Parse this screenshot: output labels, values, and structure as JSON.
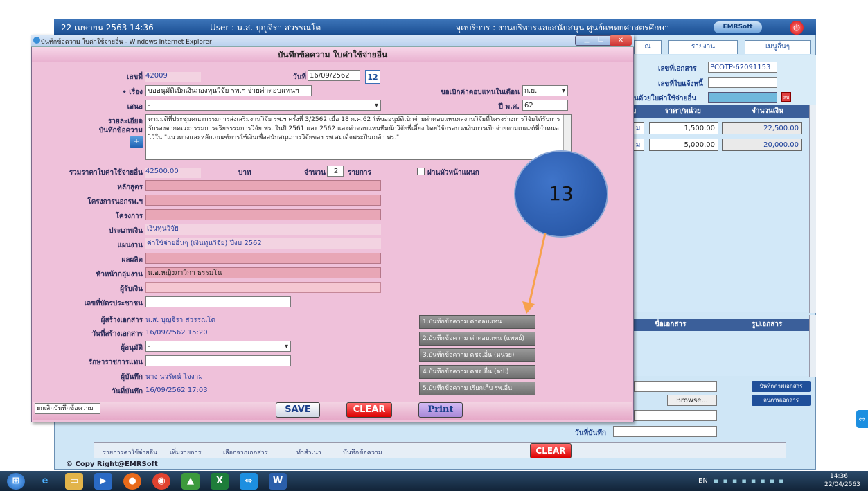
{
  "appbar": {
    "date": "22 เมษายน 2563 14:36",
    "user": "User : น.ส. บุญจิรา สวรรณโต",
    "dept": "จุดบริการ : งานบริหารและสนับสนุน ศูนย์แพทยศาสตรศึกษา",
    "logo": "EMRSoft"
  },
  "right_panel": {
    "tabs": [
      "ณ",
      "รายงาน",
      "เมนูอื่นๆ"
    ],
    "doc_no_label": "เลขที่เอกสาร",
    "doc_no": "PCOTP-62091153",
    "notify_label": "เลขที่ใบแจ้งหนี้",
    "expense_label": "นด้วยใบค่าใช้จ่ายอื่น",
    "col_unit_price": "ราคา/หน่วย",
    "col_amount": "จำนวนเงิน",
    "rows": [
      {
        "tag": "ม",
        "unit_price": "1,500.00",
        "amount": "22,500.00"
      },
      {
        "tag": "ม",
        "unit_price": "5,000.00",
        "amount": "20,000.00"
      }
    ],
    "col_doc_name": "ชื่อเอกสาร",
    "col_doc_type": "รูปเอกสาร",
    "save_doc_btn": "บันทึกภาพเอกสาร",
    "remove_doc_btn": "ลบภาพเอกสาร",
    "browse_btn": "Browse...",
    "record_date_label": "วันที่บันทึก"
  },
  "bottom_bar": {
    "links": [
      "รายการค่าใช้จ่ายอื่น",
      "เพิ่มรายการ",
      "เลือกจากเอกสาร",
      "ทำสำเนา",
      "บันทึกข้อความ"
    ],
    "clear": "CLEAR",
    "copyright": "© Copy Right@EMRSoft"
  },
  "dialog": {
    "window_title": "บันทึกข้อความ ใบค่าใช้จ่ายอื่น - Windows Internet Explorer",
    "header": "บันทึกข้อความ ใบค่าใช้จ่ายอื่น",
    "no_label": "เลขที่",
    "no_value": "42009",
    "date_label": "วันที่",
    "date_value": "16/09/2562",
    "cal_day": "12",
    "subject_label": "• เรื่อง",
    "subject_value": "ขออนุมัติเบิกเงินกองทุนวิจัย รพ.ฯ จ่ายค่าตอบแทนฯ",
    "claim_month_label": "ขอเบิกค่าตอบแทนในเดือน",
    "claim_month_value": "ก.ย.",
    "propose_label": "เสนอ",
    "propose_value": "-",
    "year_label": "ปี พ.ศ.",
    "year_value": "62",
    "detail_label_1": "รายละเอียด",
    "detail_label_2": "บันทึกข้อความ",
    "detail_text": "ตามมติที่ประชุมคณะกรรมการส่งเสริมงานวิจัย รพ.ฯ ครั้งที่ 3/2562 เมื่อ 18 ก.ค.62 ให้ขออนุมัติเบิกจ่ายค่าตอบแทนผลงานวิจัยที่โครงร่างการวิจัยได้รับการรับรองจากคณะกรรมการจริยธรรมการวิจัย พร. ในปี 2561 และ 2562 และค่าตอบแทนทีมนักวิจัยพี่เลี้ยง โดยใช้กรอบวงเงินการเบิกจ่ายตามเกณฑ์ที่กำหนดไว้ใน \"แนวทางและหลักเกณฑ์การใช้เงินเพื่อสนับสนุนการวิจัยของ รพ.สมเด็จพระปิ่นเกล้า พร.\"",
    "total_label": "รวมราคาใบค่าใช้จ่ายอื่น",
    "total_value": "42500.00",
    "baht": "บาท",
    "count_label": "จำนวน",
    "count_value": "2",
    "items": "รายการ",
    "via_head_label": "ผ่านหัวหน้าแผนก",
    "course_label": "หลักสูตร",
    "project_ops_label": "โครงการนอกรพ.ฯ",
    "project_label": "โครงการ",
    "money_type_label": "ประเภทเงิน",
    "money_type_value": "เงินทุนวิจัย",
    "plan_label": "แผนงาน",
    "plan_value": "ค่าใช้จ่ายอื่นๆ (เงินทุนวิจัย) ปีงบ 2562",
    "output_label": "ผลผลิต",
    "group_head_label": "หัวหน้ากลุ่มงาน",
    "group_head_value": "น.อ.หญิงภาวิกา ธรรมโน",
    "receiver_label": "ผู้รับเงิน",
    "id_label": "เลขที่บัตรประชาชน",
    "creator_label": "ผู้สร้างเอกสาร",
    "creator_value": "น.ส. บุญจิรา สวรรณโต",
    "created_label": "วันที่สร้างเอกสาร",
    "created_value": "16/09/2562 15:20",
    "approver_label": "ผู้อนุมัติ",
    "approver_value": "-",
    "acting_label": "รักษาราชการแทน",
    "recorder_label": "ผู้บันทึก",
    "recorder_value": "นาง นวรัตน์ ไจงาม",
    "recorded_label": "วันที่บันทึก",
    "recorded_value": "16/09/2562 17:03",
    "menu_buttons": [
      "1.บันทึกข้อความ ค่าตอบแทน",
      "2.บันทึกข้อความ ค่าตอบแทน (แพทย์)",
      "3.บันทึกข้อความ คชจ.อื่น (หน่วย)",
      "4.บันทึกข้อความ คชจ.อื่น (ตป.)",
      "5.บันทึกข้อความ เรียกเก็บ รพ.อื่น"
    ],
    "cancel_text": "ยกเลิกบันทึกข้อความ",
    "save": "SAVE",
    "clear": "CLEAR",
    "print": "Print"
  },
  "annotation": {
    "number": "13"
  },
  "taskbar": {
    "lang": "EN",
    "time": "14:36",
    "date": "22/04/2563"
  }
}
